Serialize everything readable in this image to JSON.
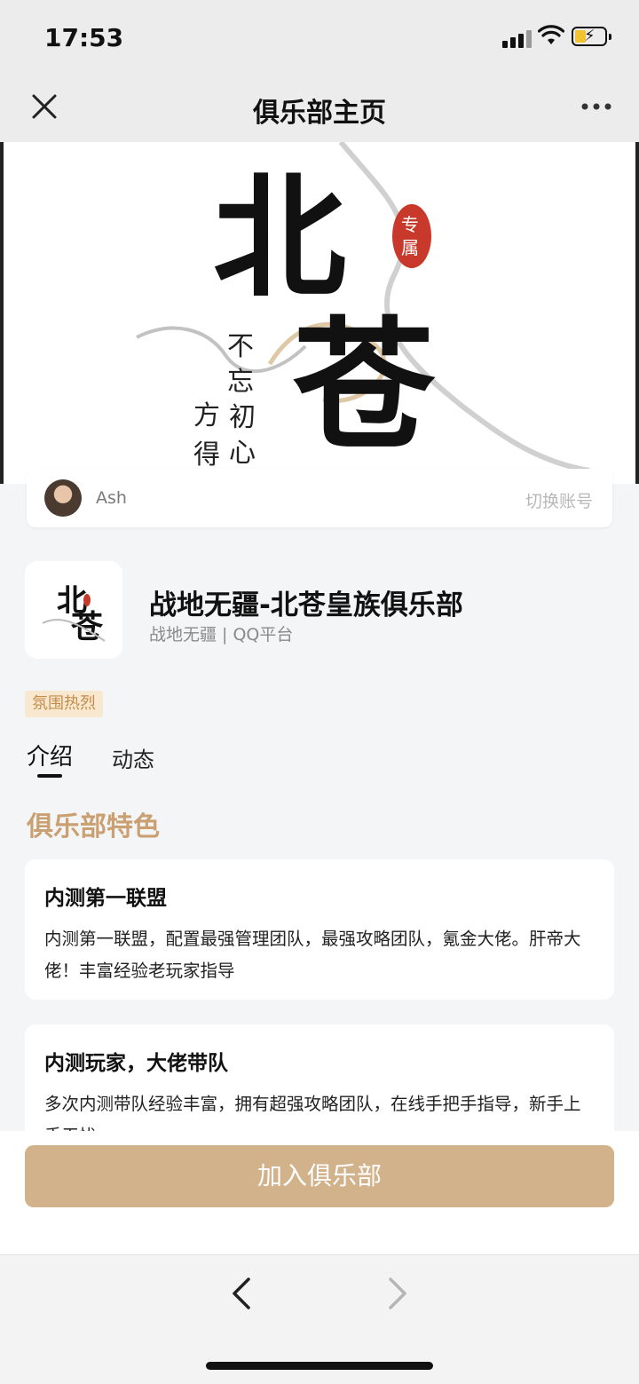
{
  "status_bar": {
    "time": "17:53"
  },
  "nav": {
    "title": "俱乐部主页"
  },
  "account": {
    "name": "Ash",
    "switch_label": "切换账号"
  },
  "club": {
    "name": "战地无疆-北苍皇族俱乐部",
    "subtitle": "战地无疆 | QQ平台",
    "tag": "氛围热烈"
  },
  "banner": {
    "brush_text": [
      "北",
      "苍"
    ],
    "seal_text": "专属",
    "verse_lines": [
      "不忘初心",
      "方得始终"
    ]
  },
  "tabs": [
    {
      "label": "介绍"
    },
    {
      "label": "动态"
    }
  ],
  "section": {
    "title": "俱乐部特色"
  },
  "features": [
    {
      "title": "内测第一联盟",
      "body": "内测第一联盟，配置最强管理团队，最强攻略团队，氪金大佬。肝帝大佬！丰富经验老玩家指导"
    },
    {
      "title": "内测玩家，大佬带队",
      "body": "多次内测带队经验丰富，拥有超强攻略团队，在线手把手指导，新手上手无忧"
    }
  ],
  "join_button": {
    "label": "加入俱乐部"
  },
  "colors": {
    "accent_gold": "#d1b28a",
    "section_title": "#caa072",
    "tag_bg": "#f8e8cf",
    "tag_text": "#c48d4a"
  }
}
